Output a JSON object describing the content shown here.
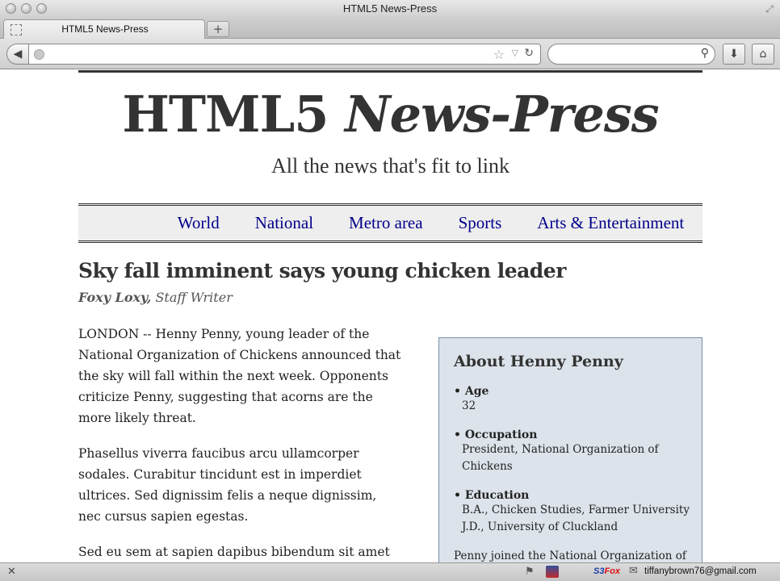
{
  "window": {
    "title": "HTML5 News-Press"
  },
  "tabs": [
    {
      "label": "HTML5 News-Press"
    }
  ],
  "toolbar": {
    "url": "",
    "search_placeholder": ""
  },
  "site": {
    "masthead_main": "HTML5 ",
    "masthead_italic": "News-Press",
    "tagline": "All the news that's fit to link",
    "nav": [
      "World",
      "National",
      "Metro area",
      "Sports",
      "Arts & Entertainment"
    ]
  },
  "article": {
    "headline": "Sky fall imminent says young chicken leader",
    "author": "Foxy Loxy,",
    "role": "Staff Writer",
    "paragraphs": [
      "LONDON -- Henny Penny, young leader of the National Organization of Chickens announced that the sky will fall within the next week. Opponents criticize Penny, suggesting that acorns are the more likely threat.",
      "Phasellus viverra faucibus arcu ullamcorper sodales. Curabitur tincidunt est in imperdiet ultrices. Sed dignissim felis a neque dignissim, nec cursus sapien egestas.",
      "Sed eu sem at sapien dapibus bibendum sit amet et"
    ]
  },
  "aside": {
    "title": "About Henny Penny",
    "facts": [
      {
        "label": "Age",
        "values": [
          "32"
        ]
      },
      {
        "label": "Occupation",
        "values": [
          "President, National Organization of Chickens"
        ]
      },
      {
        "label": "Education",
        "values": [
          "B.A., Chicken Studies, Farmer University",
          "J.D., University of Cluckland"
        ]
      }
    ],
    "footer_text": "Penny joined the National Organization of"
  },
  "statusbar": {
    "s3fox_s3": "S3",
    "s3fox_fox": "Fox",
    "email": "tiffanybrown76@gmail.com"
  },
  "icons": {
    "back": "back-arrow-icon",
    "reload": "reload-icon",
    "bookmark": "star-icon",
    "search": "search-icon",
    "download": "download-icon",
    "home": "home-icon",
    "close": "close-icon",
    "mail": "mail-icon",
    "flag": "flag-icon"
  }
}
